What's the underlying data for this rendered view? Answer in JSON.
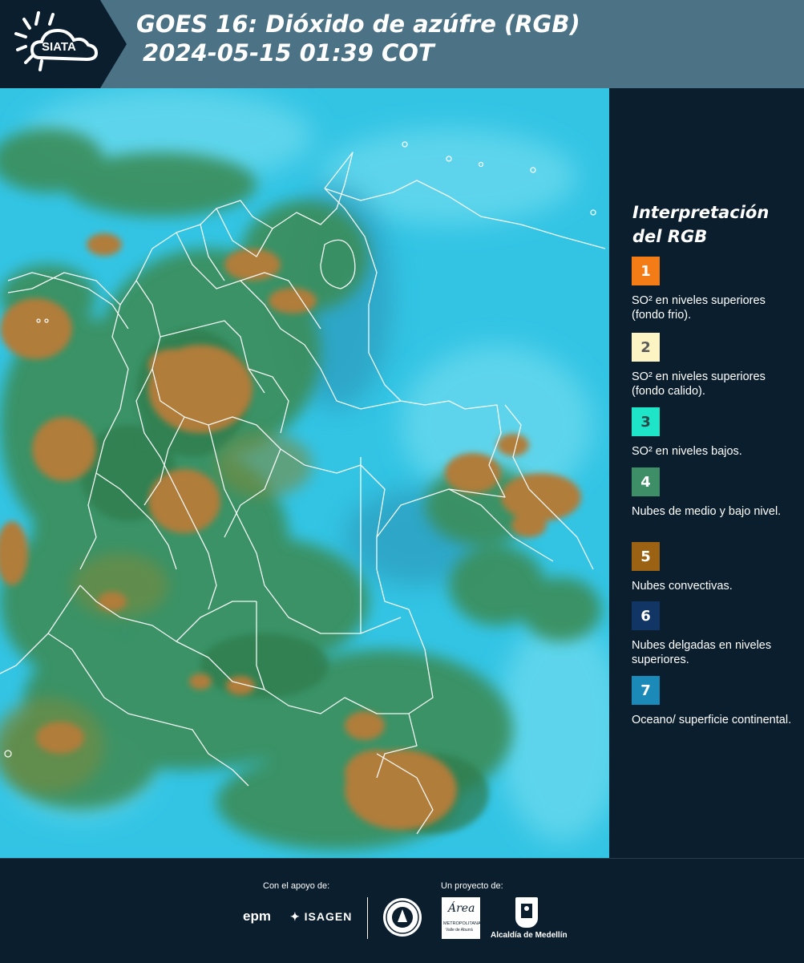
{
  "header": {
    "logo_text": "SIATA",
    "title_line1": "GOES 16: Dióxido de azúfre (RGB)",
    "title_line2": "2024-05-15 01:39 COT"
  },
  "legend": {
    "title_line1": "Interpretación",
    "title_line2": "del RGB",
    "items": [
      {
        "number": "1",
        "color": "#f47c16",
        "text_color": "#ffffff",
        "label": "SO² en niveles superiores (fondo frio)."
      },
      {
        "number": "2",
        "color": "#fdf4c4",
        "text_color": "#5a5a5a",
        "label": "SO² en niveles superiores (fondo calido)."
      },
      {
        "number": "3",
        "color": "#1ee5c8",
        "text_color": "#2a4a4a",
        "label": "SO² en niveles bajos."
      },
      {
        "number": "4",
        "color": "#3e8f68",
        "text_color": "#ffffff",
        "label": "Nubes de medio y bajo nivel."
      },
      {
        "number": "5",
        "color": "#9a6212",
        "text_color": "#ffffff",
        "label": "Nubes convectivas."
      },
      {
        "number": "6",
        "color": "#113666",
        "text_color": "#ffffff",
        "label": "Nubes delgadas en niveles superiores."
      },
      {
        "number": "7",
        "color": "#1b8ab8",
        "text_color": "#ffffff",
        "label": "Oceano/ superficie continental."
      }
    ]
  },
  "footer": {
    "support_label": "Con el apoyo de:",
    "project_label": "Un proyecto de:",
    "sponsor_1": "epm",
    "sponsor_2": "ISAGEN",
    "partner_1_line1": "Área",
    "partner_1_line2": "METROPOLITANA",
    "partner_1_line3": "Valle de Aburrá",
    "partner_2": "Alcaldía de Medellín"
  },
  "colors": {
    "header_bg": "#4c7286",
    "panel_bg": "#0b1e2d",
    "ocean_cyan": "#2ec8e6",
    "land_green": "#3c8e5a",
    "convective_brown": "#a87a38"
  }
}
